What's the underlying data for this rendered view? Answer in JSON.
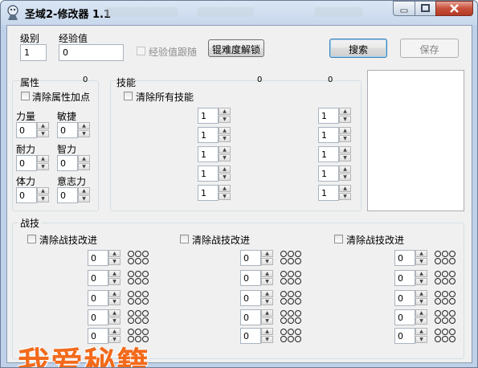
{
  "window": {
    "title": "圣域2-修改器 1.1"
  },
  "top": {
    "level_label": "级别",
    "level_value": "1",
    "exp_label": "经验值",
    "exp_value": "0",
    "exp_follow_label": "经验值跟随",
    "unlock_button": "锟难度解锁",
    "search_button": "搜索",
    "save_button": "保存"
  },
  "attributes": {
    "title": "属性",
    "count": "0",
    "clear_label": "清除属性加点",
    "fields": [
      {
        "label": "力量",
        "value": "0"
      },
      {
        "label": "敏捷",
        "value": "0"
      },
      {
        "label": "耐力",
        "value": "0"
      },
      {
        "label": "智力",
        "value": "0"
      },
      {
        "label": "体力",
        "value": "0"
      },
      {
        "label": "意志力",
        "value": "0"
      }
    ]
  },
  "skills": {
    "title": "技能",
    "count_a": "0",
    "count_b": "0",
    "clear_label": "清除所有技能",
    "col_a": [
      "1",
      "1",
      "1",
      "1",
      "1"
    ],
    "col_b": [
      "1",
      "1",
      "1",
      "1",
      "1"
    ]
  },
  "combat": {
    "title": "战技",
    "columns": [
      {
        "clear_label": "清除战技改进",
        "values": [
          "0",
          "0",
          "0",
          "0",
          "0"
        ]
      },
      {
        "clear_label": "清除战技改进",
        "values": [
          "0",
          "0",
          "0",
          "0",
          "0"
        ]
      },
      {
        "clear_label": "清除战技改进",
        "values": [
          "0",
          "0",
          "0",
          "0",
          "0"
        ]
      }
    ]
  },
  "watermark": "我爱秘籍",
  "colors": {
    "accent": "#3c7fb1",
    "watermark": "#f26a1b",
    "client_bg": "#f0f0f0"
  }
}
